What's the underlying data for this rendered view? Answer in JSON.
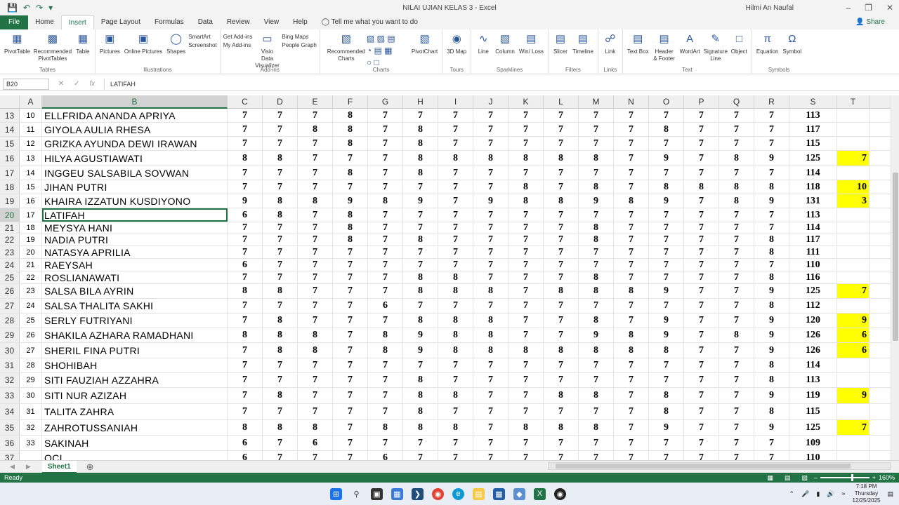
{
  "titlebar": {
    "title": "NILAI UJIAN KELAS 3  -  Excel",
    "user": "Hilmi An Naufal",
    "user_initials": "HN"
  },
  "tabs": [
    "File",
    "Home",
    "Insert",
    "Page Layout",
    "Formulas",
    "Data",
    "Review",
    "View",
    "Help"
  ],
  "tell_me": "Tell me what you want to do",
  "share": "Share",
  "ribbon": {
    "tables": {
      "label": "Tables",
      "pivot": "PivotTable",
      "recommended": "Recommended PivotTables",
      "table": "Table"
    },
    "illustrations": {
      "label": "Illustrations",
      "pictures": "Pictures",
      "online": "Online Pictures",
      "shapes": "Shapes",
      "smartart": "SmartArt",
      "screenshot": "Screenshot"
    },
    "addins": {
      "label": "Add-ins",
      "get": "Get Add-ins",
      "my": "My Add-ins",
      "visio": "Visio Data Visualizer",
      "bing": "Bing Maps",
      "people": "People Graph"
    },
    "charts": {
      "label": "Charts",
      "recommended": "Recommended Charts",
      "pivotchart": "PivotChart"
    },
    "tours": {
      "label": "Tours",
      "map": "3D Map"
    },
    "sparklines": {
      "label": "Sparklines",
      "line": "Line",
      "column": "Column",
      "winloss": "Win/ Loss"
    },
    "filters": {
      "label": "Filters",
      "slicer": "Slicer",
      "timeline": "Timeline"
    },
    "links": {
      "label": "Links",
      "link": "Link"
    },
    "text": {
      "label": "Text",
      "textbox": "Text Box",
      "header": "Header & Footer",
      "wordart": "WordArt",
      "signature": "Signature Line",
      "object": "Object"
    },
    "symbols": {
      "label": "Symbols",
      "equation": "Equation",
      "symbol": "Symbol"
    }
  },
  "formula_bar": {
    "name_box": "B20",
    "formula": "LATIFAH"
  },
  "columns": [
    "A",
    "B",
    "C",
    "D",
    "E",
    "F",
    "G",
    "H",
    "I",
    "J",
    "K",
    "L",
    "M",
    "N",
    "O",
    "P",
    "Q",
    "R",
    "S",
    "T"
  ],
  "rows": [
    {
      "r": "13",
      "no": "10",
      "name": "ELLFRIDA ANANDA APRIYA",
      "v": [
        "7",
        "7",
        "7",
        "8",
        "7",
        "7",
        "7",
        "7",
        "7",
        "7",
        "7",
        "7",
        "7",
        "7",
        "7",
        "7"
      ],
      "total": "113",
      "t": ""
    },
    {
      "r": "14",
      "no": "11",
      "name": "GIYOLA AULIA RHESA",
      "v": [
        "7",
        "7",
        "8",
        "8",
        "7",
        "8",
        "7",
        "7",
        "7",
        "7",
        "7",
        "7",
        "8",
        "7",
        "7",
        "7"
      ],
      "total": "117",
      "t": ""
    },
    {
      "r": "15",
      "no": "12",
      "name": "GRIZKA AYUNDA DEWI IRAWAN",
      "v": [
        "7",
        "7",
        "7",
        "8",
        "7",
        "8",
        "7",
        "7",
        "7",
        "7",
        "7",
        "7",
        "7",
        "7",
        "7",
        "7"
      ],
      "total": "115",
      "t": ""
    },
    {
      "r": "16",
      "no": "13",
      "name": "HILYA AGUSTIAWATI",
      "v": [
        "8",
        "8",
        "7",
        "7",
        "7",
        "8",
        "8",
        "8",
        "8",
        "8",
        "8",
        "7",
        "9",
        "7",
        "8",
        "9"
      ],
      "total": "125",
      "t": "7"
    },
    {
      "r": "17",
      "no": "14",
      "name": "INGGEU SALSABILA SOVWAN",
      "v": [
        "7",
        "7",
        "7",
        "8",
        "7",
        "8",
        "7",
        "7",
        "7",
        "7",
        "7",
        "7",
        "7",
        "7",
        "7",
        "7"
      ],
      "total": "114",
      "t": ""
    },
    {
      "r": "18",
      "no": "15",
      "name": "JIHAN PUTRI",
      "v": [
        "7",
        "7",
        "7",
        "7",
        "7",
        "7",
        "7",
        "7",
        "8",
        "7",
        "8",
        "7",
        "8",
        "8",
        "8",
        "8"
      ],
      "total": "118",
      "t": "10"
    },
    {
      "r": "19",
      "no": "16",
      "name": "KHAIRA IZZATUN KUSDIYONO",
      "v": [
        "9",
        "8",
        "8",
        "9",
        "8",
        "9",
        "7",
        "9",
        "8",
        "8",
        "9",
        "8",
        "9",
        "7",
        "8",
        "9"
      ],
      "total": "131",
      "t": "3"
    },
    {
      "r": "20",
      "no": "17",
      "name": "LATIFAH",
      "v": [
        "6",
        "8",
        "7",
        "8",
        "7",
        "7",
        "7",
        "7",
        "7",
        "7",
        "7",
        "7",
        "7",
        "7",
        "7",
        "7"
      ],
      "total": "113",
      "t": ""
    },
    {
      "r": "21",
      "no": "18",
      "name": "MEYSYA HANI",
      "v": [
        "7",
        "7",
        "7",
        "8",
        "7",
        "7",
        "7",
        "7",
        "7",
        "7",
        "8",
        "7",
        "7",
        "7",
        "7",
        "7"
      ],
      "total": "114",
      "t": ""
    },
    {
      "r": "22",
      "no": "19",
      "name": "NADIA PUTRI",
      "v": [
        "7",
        "7",
        "7",
        "8",
        "7",
        "8",
        "7",
        "7",
        "7",
        "7",
        "8",
        "7",
        "7",
        "7",
        "7",
        "8"
      ],
      "total": "117",
      "t": ""
    },
    {
      "r": "23",
      "no": "20",
      "name": "NATASYA APRILIA",
      "v": [
        "7",
        "7",
        "7",
        "7",
        "7",
        "7",
        "7",
        "7",
        "7",
        "7",
        "7",
        "7",
        "7",
        "7",
        "7",
        "8"
      ],
      "total": "111",
      "t": ""
    },
    {
      "r": "24",
      "no": "21",
      "name": "RAEYSAH",
      "v": [
        "6",
        "7",
        "7",
        "7",
        "7",
        "7",
        "7",
        "7",
        "7",
        "7",
        "7",
        "7",
        "7",
        "7",
        "7",
        "7"
      ],
      "total": "110",
      "t": ""
    },
    {
      "r": "25",
      "no": "22",
      "name": "ROSLIANAWATI",
      "v": [
        "7",
        "7",
        "7",
        "7",
        "7",
        "8",
        "8",
        "7",
        "7",
        "7",
        "8",
        "7",
        "7",
        "7",
        "7",
        "8"
      ],
      "total": "116",
      "t": ""
    },
    {
      "r": "26",
      "no": "23",
      "name": "SALSA BILA AYRIN",
      "v": [
        "8",
        "8",
        "7",
        "7",
        "7",
        "8",
        "8",
        "8",
        "7",
        "8",
        "8",
        "8",
        "9",
        "7",
        "7",
        "9"
      ],
      "total": "125",
      "t": "7"
    },
    {
      "r": "27",
      "no": "24",
      "name": "SALSA THALITA SAKHI",
      "v": [
        "7",
        "7",
        "7",
        "7",
        "6",
        "7",
        "7",
        "7",
        "7",
        "7",
        "7",
        "7",
        "7",
        "7",
        "7",
        "8"
      ],
      "total": "112",
      "t": ""
    },
    {
      "r": "28",
      "no": "25",
      "name": "SERLY FUTRIYANI",
      "v": [
        "7",
        "8",
        "7",
        "7",
        "7",
        "8",
        "8",
        "8",
        "7",
        "7",
        "8",
        "7",
        "9",
        "7",
        "7",
        "9"
      ],
      "total": "120",
      "t": "9"
    },
    {
      "r": "29",
      "no": "26",
      "name": "SHAKILA AZHARA RAMADHANI",
      "v": [
        "8",
        "8",
        "8",
        "7",
        "8",
        "9",
        "8",
        "8",
        "7",
        "7",
        "9",
        "8",
        "9",
        "7",
        "8",
        "9"
      ],
      "total": "126",
      "t": "6"
    },
    {
      "r": "30",
      "no": "27",
      "name": "SHERIL FINA PUTRI",
      "v": [
        "7",
        "8",
        "8",
        "7",
        "8",
        "9",
        "8",
        "8",
        "8",
        "8",
        "8",
        "8",
        "8",
        "7",
        "7",
        "9"
      ],
      "total": "126",
      "t": "6"
    },
    {
      "r": "31",
      "no": "28",
      "name": "SHOHIBAH",
      "v": [
        "7",
        "7",
        "7",
        "7",
        "7",
        "7",
        "7",
        "7",
        "7",
        "7",
        "7",
        "7",
        "7",
        "7",
        "7",
        "8"
      ],
      "total": "114",
      "t": ""
    },
    {
      "r": "32",
      "no": "29",
      "name": "SITI FAUZIAH AZZAHRA",
      "v": [
        "7",
        "7",
        "7",
        "7",
        "7",
        "8",
        "7",
        "7",
        "7",
        "7",
        "7",
        "7",
        "7",
        "7",
        "7",
        "8"
      ],
      "total": "113",
      "t": ""
    },
    {
      "r": "33",
      "no": "30",
      "name": "SITI NUR AZIZAH",
      "v": [
        "7",
        "8",
        "7",
        "7",
        "7",
        "8",
        "8",
        "7",
        "7",
        "8",
        "8",
        "7",
        "8",
        "7",
        "7",
        "9"
      ],
      "total": "119",
      "t": "9"
    },
    {
      "r": "34",
      "no": "31",
      "name": "TALITA ZAHRA",
      "v": [
        "7",
        "7",
        "7",
        "7",
        "7",
        "8",
        "7",
        "7",
        "7",
        "7",
        "7",
        "7",
        "8",
        "7",
        "7",
        "8"
      ],
      "total": "115",
      "t": ""
    },
    {
      "r": "35",
      "no": "32",
      "name": "ZAHROTUSSANIAH",
      "v": [
        "8",
        "8",
        "8",
        "7",
        "8",
        "8",
        "8",
        "7",
        "8",
        "8",
        "8",
        "7",
        "9",
        "7",
        "7",
        "9"
      ],
      "total": "125",
      "t": "7"
    },
    {
      "r": "36",
      "no": "33",
      "name": "SAKINAH",
      "v": [
        "6",
        "7",
        "6",
        "7",
        "7",
        "7",
        "7",
        "7",
        "7",
        "7",
        "7",
        "7",
        "7",
        "7",
        "7",
        "7"
      ],
      "total": "109",
      "t": ""
    },
    {
      "r": "37",
      "no": "",
      "name": "OCI",
      "v": [
        "6",
        "7",
        "7",
        "7",
        "6",
        "7",
        "7",
        "7",
        "7",
        "7",
        "7",
        "7",
        "7",
        "7",
        "7",
        "7"
      ],
      "total": "110",
      "t": ""
    }
  ],
  "sheet_tab": "Sheet1",
  "status": {
    "ready": "Ready",
    "zoom": "160%"
  },
  "taskbar": {
    "time": "7:18 PM",
    "day": "Thursday",
    "date": "12/25/2025"
  },
  "colors": {
    "excel_green": "#217346",
    "highlight": "#ffff00"
  }
}
